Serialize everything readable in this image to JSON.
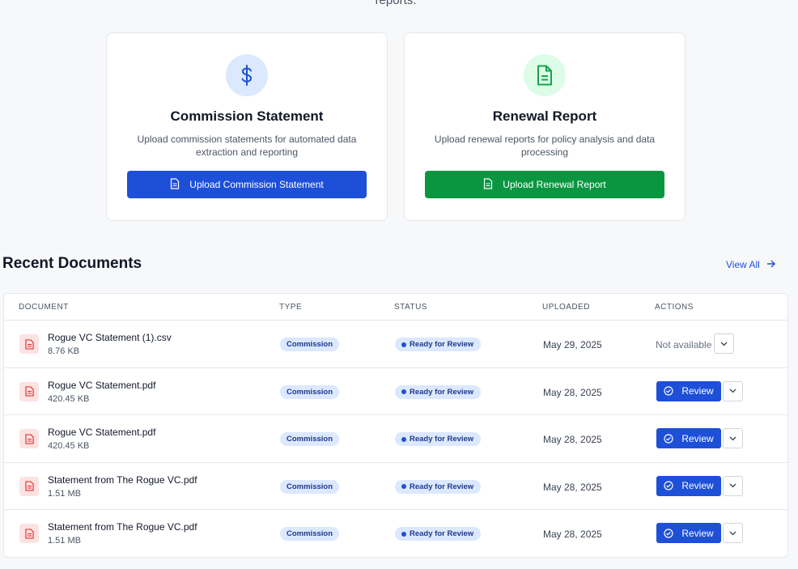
{
  "intro": {
    "trailing_text": "reports."
  },
  "cards": [
    {
      "icon": "dollar-icon",
      "title": "Commission Statement",
      "description": "Upload commission statements for automated data extraction and reporting",
      "button_label": "Upload Commission Statement",
      "accent": "#1d4fd8"
    },
    {
      "icon": "document-icon",
      "title": "Renewal Report",
      "description": "Upload renewal reports for policy analysis and data processing",
      "button_label": "Upload Renewal Report",
      "accent": "#0a9640"
    }
  ],
  "recent": {
    "title": "Recent Documents",
    "view_all": "View All",
    "columns": [
      "DOCUMENT",
      "TYPE",
      "STATUS",
      "UPLOADED",
      "ACTIONS"
    ],
    "rows": [
      {
        "name": "Rogue VC Statement (1).csv",
        "size": "8.76 KB",
        "type": "Commission",
        "status": "Ready for Review",
        "uploaded": "May 29, 2025",
        "action": "Not available"
      },
      {
        "name": "Rogue VC Statement.pdf",
        "size": "420.45 KB",
        "type": "Commission",
        "status": "Ready for Review",
        "uploaded": "May 28, 2025",
        "action": "Review"
      },
      {
        "name": "Rogue VC Statement.pdf",
        "size": "420.45 KB",
        "type": "Commission",
        "status": "Ready for Review",
        "uploaded": "May 28, 2025",
        "action": "Review"
      },
      {
        "name": "Statement from The Rogue VC.pdf",
        "size": "1.51 MB",
        "type": "Commission",
        "status": "Ready for Review",
        "uploaded": "May 28, 2025",
        "action": "Review"
      },
      {
        "name": "Statement from The Rogue VC.pdf",
        "size": "1.51 MB",
        "type": "Commission",
        "status": "Ready for Review",
        "uploaded": "May 28, 2025",
        "action": "Review"
      }
    ]
  }
}
